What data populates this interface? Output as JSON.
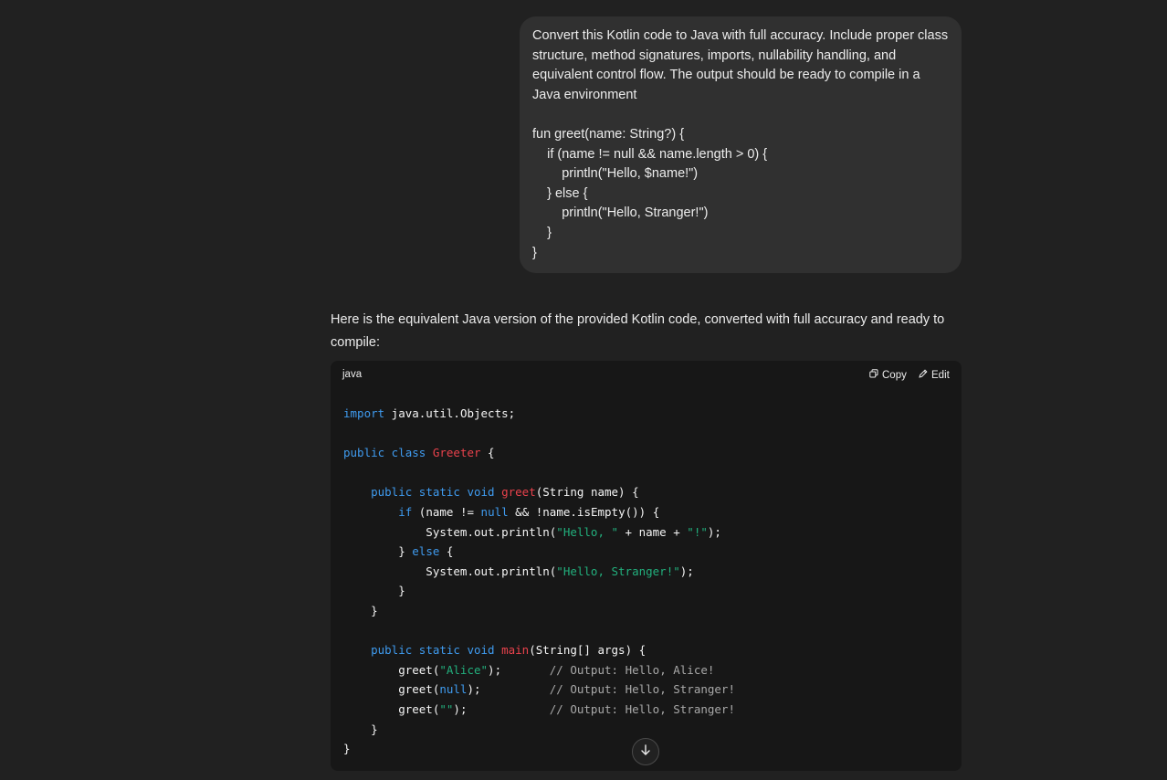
{
  "user_message": {
    "paragraph_lines": [
      "Convert this Kotlin code to Java with full accuracy. Include proper class",
      "structure, method signatures, imports, nullability handling, and",
      "equivalent control flow. The output should be ready to compile in a",
      "Java environment"
    ],
    "code_lines": [
      "fun greet(name: String?) {",
      "    if (name != null && name.length > 0) {",
      "        println(\"Hello, $name!\")",
      "    } else {",
      "        println(\"Hello, Stranger!\")",
      "    }",
      "}"
    ]
  },
  "assistant_message": {
    "intro_line_1": "Here is the equivalent Java version of the provided Kotlin code, converted with full accuracy and ready to",
    "intro_line_2": "compile:",
    "code_block": {
      "language": "java",
      "copy_label": "Copy",
      "edit_label": "Edit",
      "lines": [
        [
          {
            "t": "import",
            "c": "kw"
          },
          {
            "t": " java.util.Objects;",
            "c": ""
          }
        ],
        [],
        [
          {
            "t": "public class",
            "c": "kw"
          },
          {
            "t": " ",
            "c": ""
          },
          {
            "t": "Greeter",
            "c": "fn"
          },
          {
            "t": " {",
            "c": ""
          }
        ],
        [],
        [
          {
            "t": "    ",
            "c": ""
          },
          {
            "t": "public static void",
            "c": "kw"
          },
          {
            "t": " ",
            "c": ""
          },
          {
            "t": "greet",
            "c": "fn"
          },
          {
            "t": "(String name) {",
            "c": ""
          }
        ],
        [
          {
            "t": "        ",
            "c": ""
          },
          {
            "t": "if",
            "c": "kw"
          },
          {
            "t": " (name != ",
            "c": ""
          },
          {
            "t": "null",
            "c": "kw"
          },
          {
            "t": " && !name.isEmpty()) {",
            "c": ""
          }
        ],
        [
          {
            "t": "            System.out.println(",
            "c": ""
          },
          {
            "t": "\"Hello, \"",
            "c": "str"
          },
          {
            "t": " + name + ",
            "c": ""
          },
          {
            "t": "\"!\"",
            "c": "str"
          },
          {
            "t": ");",
            "c": ""
          }
        ],
        [
          {
            "t": "        } ",
            "c": ""
          },
          {
            "t": "else",
            "c": "kw"
          },
          {
            "t": " {",
            "c": ""
          }
        ],
        [
          {
            "t": "            System.out.println(",
            "c": ""
          },
          {
            "t": "\"Hello, Stranger!\"",
            "c": "str"
          },
          {
            "t": ");",
            "c": ""
          }
        ],
        [
          {
            "t": "        }",
            "c": ""
          }
        ],
        [
          {
            "t": "    }",
            "c": ""
          }
        ],
        [],
        [
          {
            "t": "    ",
            "c": ""
          },
          {
            "t": "public static void",
            "c": "kw"
          },
          {
            "t": " ",
            "c": ""
          },
          {
            "t": "main",
            "c": "fn"
          },
          {
            "t": "(String[] args) {",
            "c": ""
          }
        ],
        [
          {
            "t": "        greet(",
            "c": ""
          },
          {
            "t": "\"Alice\"",
            "c": "str"
          },
          {
            "t": ");       ",
            "c": ""
          },
          {
            "t": "// Output: Hello, Alice!",
            "c": "cm"
          }
        ],
        [
          {
            "t": "        greet(",
            "c": ""
          },
          {
            "t": "null",
            "c": "kw"
          },
          {
            "t": ");          ",
            "c": ""
          },
          {
            "t": "// Output: Hello, Stranger!",
            "c": "cm"
          }
        ],
        [
          {
            "t": "        greet(",
            "c": ""
          },
          {
            "t": "\"\"",
            "c": "str"
          },
          {
            "t": ");            ",
            "c": ""
          },
          {
            "t": "// Output: Hello, Stranger!",
            "c": "cm"
          }
        ],
        [
          {
            "t": "    }",
            "c": ""
          }
        ],
        [
          {
            "t": "}",
            "c": ""
          }
        ]
      ]
    }
  },
  "icons": {
    "copy": "copy-icon",
    "edit": "edit-pencil-icon",
    "scroll": "arrow-down-icon"
  },
  "colors": {
    "background": "#212121",
    "user_bubble": "#303030",
    "code_background": "#171717",
    "keyword": "#3f9bef",
    "function_name": "#e9424c",
    "string": "#22b07d",
    "comment": "#a8a8a8"
  }
}
